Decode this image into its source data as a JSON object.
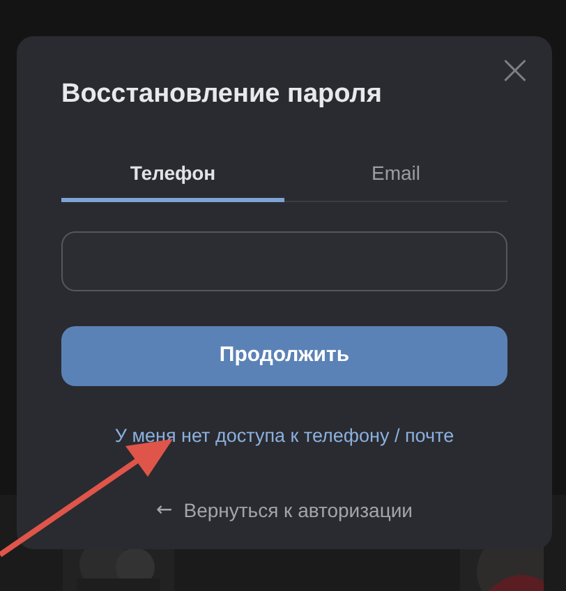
{
  "dialog": {
    "title": "Восстановление пароля",
    "close": "×"
  },
  "tabs": [
    {
      "label": "Телефон",
      "selected": true
    },
    {
      "label": "Email",
      "selected": false
    }
  ],
  "continue_button": "Продолжить",
  "no_access_link": "У меня нет доступа к телефону / почте",
  "back_link": {
    "arrow": "←",
    "label": "Вернуться к авторизации"
  }
}
